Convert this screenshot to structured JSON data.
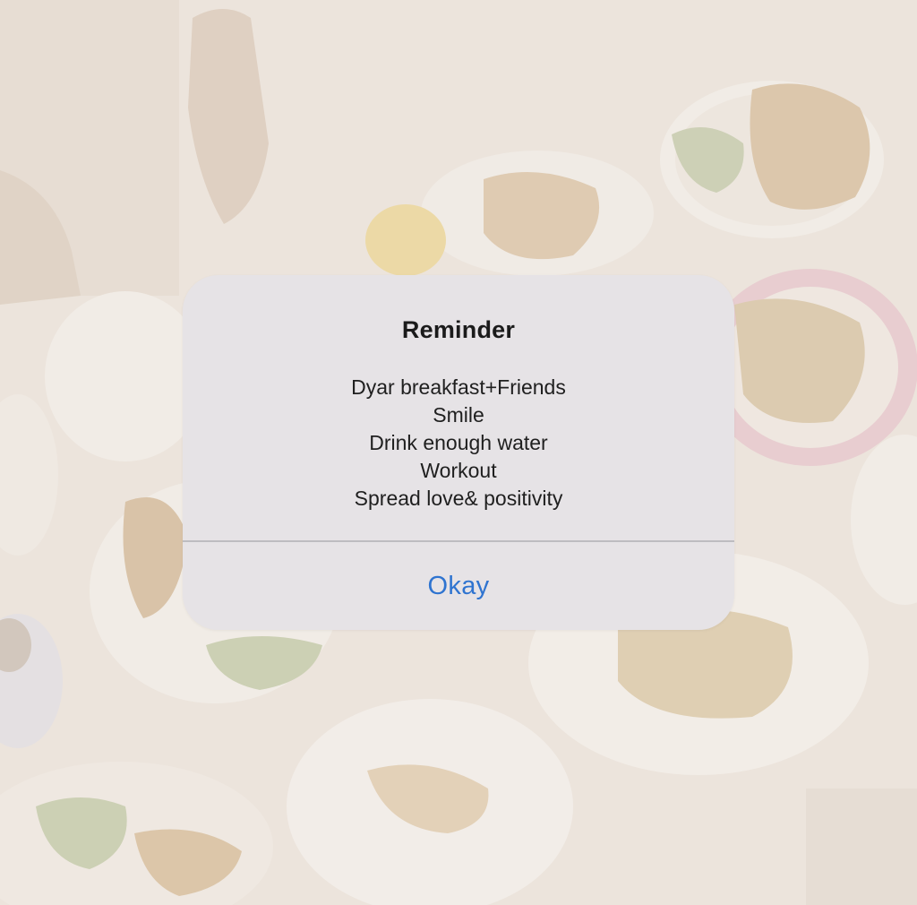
{
  "alert": {
    "title": "Reminder",
    "message_lines": [
      "Dyar breakfast+Friends",
      "Smile",
      "Drink enough water",
      "Workout",
      "Spread love& positivity"
    ],
    "button_label": "Okay"
  },
  "colors": {
    "alert_background": "#e6e3e6",
    "button_text": "#2f74d0",
    "backdrop": "#ece4dc"
  }
}
